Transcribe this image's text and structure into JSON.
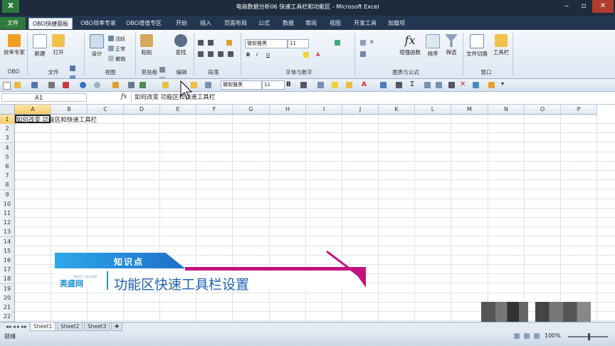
{
  "window": {
    "title": "电商数据分析06 快速工具栏和功能区 - Microsoft Excel"
  },
  "tabs": [
    "文件",
    "OBO快捷面板",
    "OBO效率专家",
    "OBO增值专区",
    "开始",
    "插入",
    "页面布局",
    "公式",
    "数据",
    "审阅",
    "视图",
    "开发工具",
    "加载项"
  ],
  "ribbon": {
    "groups": [
      "OBO",
      "文件",
      "视图",
      "剪贴板",
      "编辑",
      "段落",
      "字体与数字",
      "图表与公式",
      "窗口"
    ],
    "buttons": {
      "efficiency": "效率专家",
      "new": "新建",
      "open": "打开",
      "design": "设计",
      "activate": "活跃",
      "normal": "正常",
      "cancel": "撤销",
      "paste": "粘贴",
      "find": "查找",
      "chart": "增强函数",
      "sort": "排序",
      "filter": "筛选",
      "file_switch": "文件切换",
      "toolbar": "工具栏"
    },
    "font": "微软雅黑",
    "size": "11"
  },
  "qat": {
    "font": "微软雅黑",
    "size": "11"
  },
  "formula_bar": {
    "name_box": "A1",
    "fx": "fx",
    "content": "如何改变 功能区和快速工具栏"
  },
  "sheet": {
    "columns": [
      "A",
      "B",
      "C",
      "D",
      "E",
      "F",
      "G",
      "H",
      "I",
      "J",
      "K",
      "L",
      "M",
      "N",
      "O",
      "P"
    ],
    "rows": [
      "1",
      "2",
      "3",
      "4",
      "5",
      "6",
      "7",
      "8",
      "9",
      "10",
      "11",
      "12",
      "13",
      "14",
      "15",
      "16",
      "17",
      "18",
      "19",
      "20",
      "21",
      "22"
    ],
    "a1_text": "如何改变 功能区和快速工具栏"
  },
  "banner": {
    "label": "知识点",
    "logo": "英盛网",
    "logo_sub": "管理学习 就在英盛",
    "topic": "功能区快速工具栏设置"
  },
  "sheets": [
    "Sheet1",
    "Sheet2",
    "Sheet3"
  ],
  "status": {
    "text": "就绪",
    "zoom": "100%"
  }
}
